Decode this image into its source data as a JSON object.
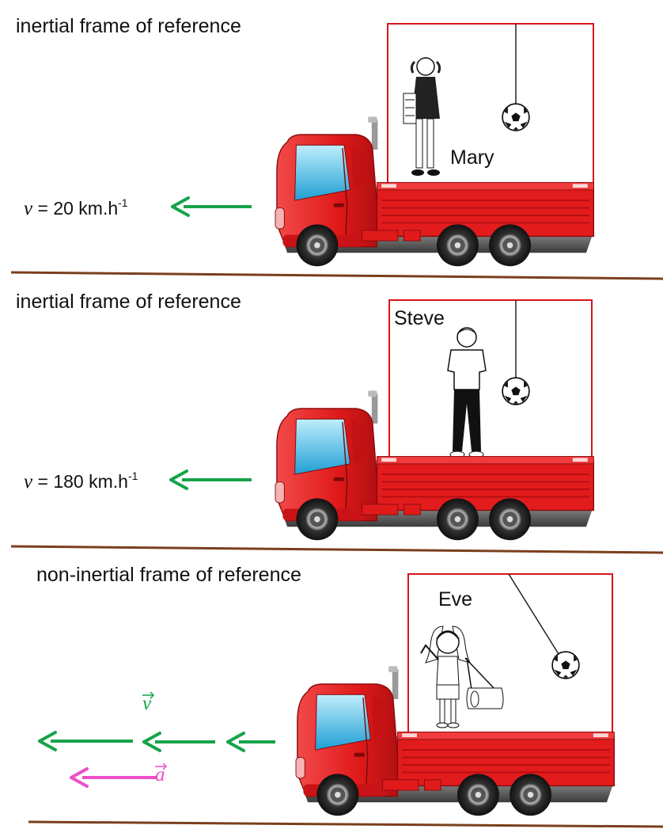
{
  "panels": [
    {
      "heading": "inertial frame of reference",
      "person": "Mary",
      "velocity": {
        "symbol": "v",
        "text": " = 20 km.h",
        "exponent": "-1"
      }
    },
    {
      "heading": "inertial frame of reference",
      "person": "Steve",
      "velocity": {
        "symbol": "v",
        "text": " = 180 km.h",
        "exponent": "-1"
      }
    },
    {
      "heading": "non-inertial frame of reference",
      "person": "Eve",
      "vector_v": "v",
      "vector_a": "a"
    }
  ],
  "colors": {
    "frame": "#d8141c",
    "truck": "#e01a1a",
    "truck_dark": "#a50f10",
    "window": "#3fb8e0",
    "velocity_arrow": "#16a34a",
    "acceleration_arrow": "#ec4fc8",
    "ground": "#7a3f1c",
    "pendulum_string": "#222222"
  },
  "icons": [
    "truck-icon",
    "soccer-ball-icon",
    "girl-icon",
    "boy-icon",
    "arrow-left-icon"
  ]
}
